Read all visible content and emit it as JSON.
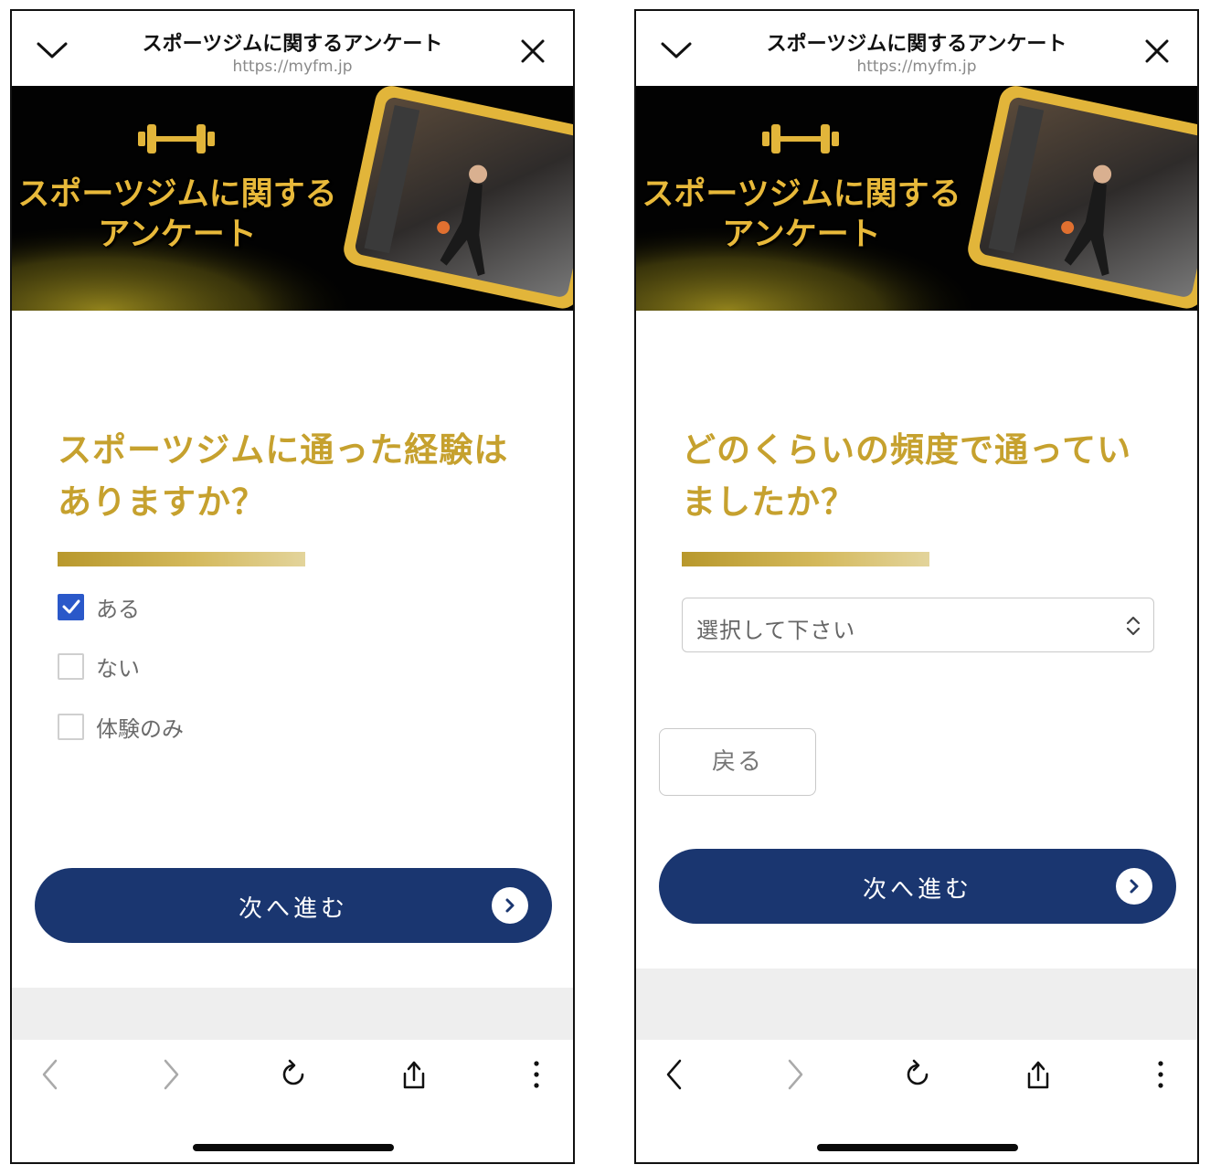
{
  "left_screen": {
    "header": {
      "title": "スポーツジムに関するアンケート",
      "url": "https://myfm.jp"
    },
    "banner": {
      "title_line1": "スポーツジムに関する",
      "title_line2": "アンケート"
    },
    "question": {
      "line1": "スポーツジムに通った経験は",
      "line2": "ありますか？"
    },
    "options": [
      {
        "label": "ある",
        "checked": true
      },
      {
        "label": "ない",
        "checked": false
      },
      {
        "label": "体験のみ",
        "checked": false
      }
    ],
    "next_button": {
      "label": "次へ進む"
    }
  },
  "right_screen": {
    "header": {
      "title": "スポーツジムに関するアンケート",
      "url": "https://myfm.jp"
    },
    "banner": {
      "title_line1": "スポーツジムに関する",
      "title_line2": "アンケート"
    },
    "question": {
      "line1": "どのくらいの頻度で通ってい",
      "line2": "ましたか？"
    },
    "select": {
      "value": "選択して下さい"
    },
    "back_button": {
      "label": "戻る"
    },
    "next_button": {
      "label": "次へ進む"
    }
  },
  "colors": {
    "accent_gold": "#c6a12e",
    "button_navy": "#1a3670",
    "checkbox_blue": "#2a58c9"
  },
  "icons": [
    "chevron-down-icon",
    "close-icon",
    "dumbbell-icon",
    "chevron-right-icon",
    "back-arrow-icon",
    "forward-arrow-icon",
    "reload-icon",
    "share-icon",
    "more-vertical-icon",
    "updown-chevron-icon",
    "checkmark-icon"
  ]
}
